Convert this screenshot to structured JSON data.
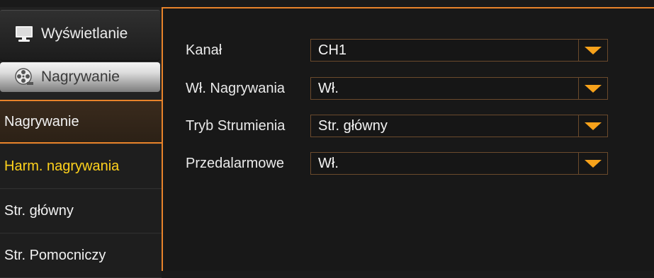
{
  "sidebar": {
    "categories": [
      {
        "label": "Wyświetlanie",
        "icon": "monitor-icon"
      },
      {
        "label": "Nagrywanie",
        "icon": "film-reel-icon"
      }
    ],
    "sub_items": [
      {
        "label": "Nagrywanie",
        "state": "active"
      },
      {
        "label": "Harm. nagrywania",
        "state": "highlighted"
      },
      {
        "label": "Str. główny",
        "state": "normal"
      },
      {
        "label": "Str. Pomocniczy",
        "state": "normal"
      }
    ]
  },
  "form": {
    "fields": [
      {
        "label": "Kanał",
        "value": "CH1"
      },
      {
        "label": "Wł. Nagrywania",
        "value": "Wł."
      },
      {
        "label": "Tryb Strumienia",
        "value": "Str. główny"
      },
      {
        "label": "Przedalarmowe",
        "value": "Wł."
      }
    ]
  },
  "colors": {
    "accent": "#e8832a",
    "highlight_text": "#ffd21c",
    "dropdown_arrow": "#f7a21b"
  }
}
